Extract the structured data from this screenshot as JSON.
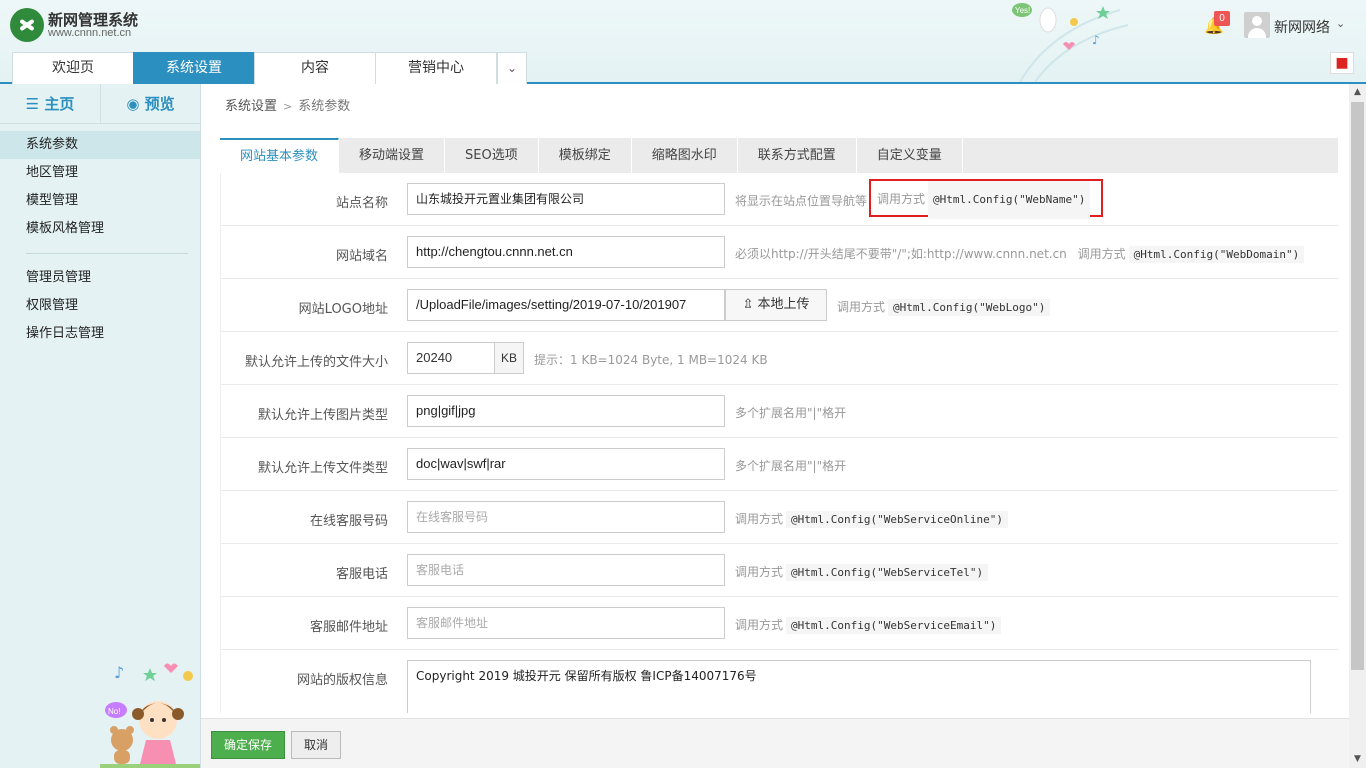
{
  "header": {
    "brand_name": "新网管理系统",
    "brand_url": "www.cnnn.net.cn",
    "nav_tabs": [
      {
        "label": "欢迎页",
        "active": false
      },
      {
        "label": "系统设置",
        "active": true
      },
      {
        "label": "内容",
        "active": false
      },
      {
        "label": "营销中心",
        "active": false
      }
    ],
    "more_icon": "chevron-down-icon",
    "notification_count": "0",
    "user_name": "新网网络",
    "accent_color": "#2b8fbf"
  },
  "sidebar": {
    "home_label": "主页",
    "preview_label": "预览",
    "group1": [
      {
        "label": "系统参数",
        "active": true
      },
      {
        "label": "地区管理",
        "active": false
      },
      {
        "label": "模型管理",
        "active": false
      },
      {
        "label": "模板风格管理",
        "active": false
      }
    ],
    "group2": [
      {
        "label": "管理员管理",
        "active": false
      },
      {
        "label": "权限管理",
        "active": false
      },
      {
        "label": "操作日志管理",
        "active": false
      }
    ]
  },
  "breadcrumb": {
    "parent": "系统设置",
    "separator": ">",
    "current": "系统参数"
  },
  "tabs": [
    {
      "label": "网站基本参数",
      "active": true
    },
    {
      "label": "移动端设置",
      "active": false
    },
    {
      "label": "SEO选项",
      "active": false
    },
    {
      "label": "模板绑定",
      "active": false
    },
    {
      "label": "缩略图水印",
      "active": false
    },
    {
      "label": "联系方式配置",
      "active": false
    },
    {
      "label": "自定义变量",
      "active": false
    }
  ],
  "form": {
    "site_name": {
      "label": "站点名称",
      "value": "山东城投开元置业集团有限公司",
      "hint": "将显示在站点位置导航等",
      "call_label": "调用方式",
      "code": "@Html.Config(\"WebName\")"
    },
    "domain": {
      "label": "网站域名",
      "value": "http://chengtou.cnnn.net.cn",
      "hint": "必须以http://开头结尾不要带\"/\";如:http://www.cnnn.net.cn",
      "call_label": "调用方式",
      "code": "@Html.Config(\"WebDomain\")"
    },
    "logo": {
      "label": "网站LOGO地址",
      "value": "/UploadFile/images/setting/2019-07-10/201907",
      "upload_label": "本地上传",
      "call_label": "调用方式",
      "code": "@Html.Config(\"WebLogo\")"
    },
    "file_size": {
      "label": "默认允许上传的文件大小",
      "value": "20240",
      "unit": "KB",
      "hint": "提示：1 KB=1024 Byte, 1 MB=1024 KB"
    },
    "image_types": {
      "label": "默认允许上传图片类型",
      "value": "png|gif|jpg",
      "hint": "多个扩展名用\"|\"格开"
    },
    "file_types": {
      "label": "默认允许上传文件类型",
      "value": "doc|wav|swf|rar",
      "hint": "多个扩展名用\"|\"格开"
    },
    "service_online": {
      "label": "在线客服号码",
      "placeholder": "在线客服号码",
      "call_label": "调用方式",
      "code": "@Html.Config(\"WebServiceOnline\")"
    },
    "service_tel": {
      "label": "客服电话",
      "placeholder": "客服电话",
      "call_label": "调用方式",
      "code": "@Html.Config(\"WebServiceTel\")"
    },
    "service_email": {
      "label": "客服邮件地址",
      "placeholder": "客服邮件地址",
      "call_label": "调用方式",
      "code": "@Html.Config(\"WebServiceEmail\")"
    },
    "copyright": {
      "label": "网站的版权信息",
      "value": "Copyright 2019 城投开元 保留所有版权   鲁ICP备14007176号"
    }
  },
  "footer": {
    "save_label": "确定保存",
    "cancel_label": "取消"
  }
}
